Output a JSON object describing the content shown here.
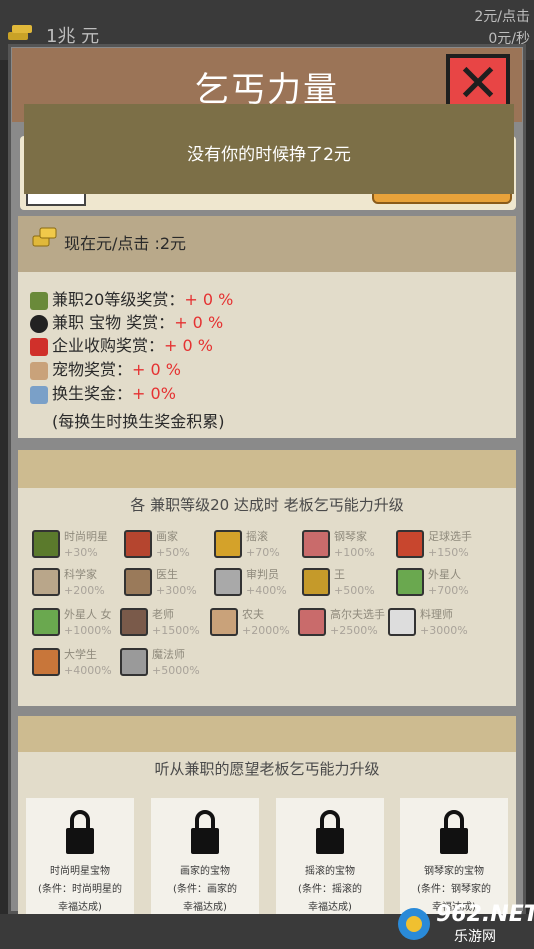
{
  "header": {
    "money": "1兆 元",
    "rate_click": "2元/点击",
    "rate_sec": "0元/秒"
  },
  "dialog": {
    "title": "乞丐力量",
    "close_icon": "close-icon"
  },
  "toast": {
    "text": "没有你的时候挣了2元"
  },
  "rate_card": {
    "label": "现在元/点击 :2元"
  },
  "bonuses": [
    {
      "label": "兼职20等级奖赏：",
      "value": "+ 0 %",
      "icon": "hat-icon",
      "color": "#6a8a3a"
    },
    {
      "label": "兼职 宝物 奖赏：",
      "value": "+ 0 %",
      "icon": "soccer-ball-icon",
      "color": "#222222"
    },
    {
      "label": "企业收购奖赏：",
      "value": "+ 0 %",
      "icon": "company-logo-icon",
      "color": "#d0302a"
    },
    {
      "label": "宠物奖赏：",
      "value": "+ 0 %",
      "icon": "dog-icon",
      "color": "#c9a27a"
    },
    {
      "label": "换生奖金：",
      "value": "+ 0%",
      "icon": "angel-icon",
      "color": "#7aa0c8"
    }
  ],
  "note": "(每换生时换生奖金积累)",
  "jobs_card": {
    "title": "各 兼职等级20 达成时 老板乞丐能力升级"
  },
  "jobs": [
    {
      "name": "时尚明星",
      "value": "+30%",
      "color": "#5b7a2c"
    },
    {
      "name": "画家",
      "value": "+50%",
      "color": "#b5452f"
    },
    {
      "name": "摇滚",
      "value": "+70%",
      "color": "#d4a22a"
    },
    {
      "name": "钢琴家",
      "value": "+100%",
      "color": "#c96b6b"
    },
    {
      "name": "足球选手",
      "value": "+150%",
      "color": "#c8462e"
    },
    {
      "name": "科学家",
      "value": "+200%",
      "color": "#b9a68a"
    },
    {
      "name": "医生",
      "value": "+300%",
      "color": "#9a7a5a"
    },
    {
      "name": "审判员",
      "value": "+400%",
      "color": "#a9a9a9"
    },
    {
      "name": "王",
      "value": "+500%",
      "color": "#c59a2a"
    },
    {
      "name": "外星人",
      "value": "+700%",
      "color": "#6aa84f"
    },
    {
      "name": "外星人 女",
      "value": "+1000%",
      "color": "#6aa84f"
    },
    {
      "name": "老师",
      "value": "+1500%",
      "color": "#7a5a4a"
    },
    {
      "name": "农夫",
      "value": "+2000%",
      "color": "#c9a27a"
    },
    {
      "name": "高尔夫选手",
      "value": "+2500%",
      "color": "#c96b6b"
    },
    {
      "name": "料理师",
      "value": "+3000%",
      "color": "#dddddd"
    },
    {
      "name": "大学生",
      "value": "+4000%",
      "color": "#c8763a"
    },
    {
      "name": "魔法师",
      "value": "+5000%",
      "color": "#9a9a9a"
    }
  ],
  "treasure_card": {
    "title": "听从兼职的愿望老板乞丐能力升级"
  },
  "treasures": [
    {
      "name": "时尚明星宝物",
      "cond": "(条件：时尚明星的",
      "cond2": "幸福达成)"
    },
    {
      "name": "画家的宝物",
      "cond": "(条件：画家的",
      "cond2": "幸福达成)"
    },
    {
      "name": "摇滚的宝物",
      "cond": "(条件：摇滚的",
      "cond2": "幸福达成)"
    },
    {
      "name": "钢琴家的宝物",
      "cond": "(条件：钢琴家的",
      "cond2": "幸福达成)"
    }
  ],
  "watermark": {
    "text": "962.NET",
    "sub": "乐游网"
  }
}
